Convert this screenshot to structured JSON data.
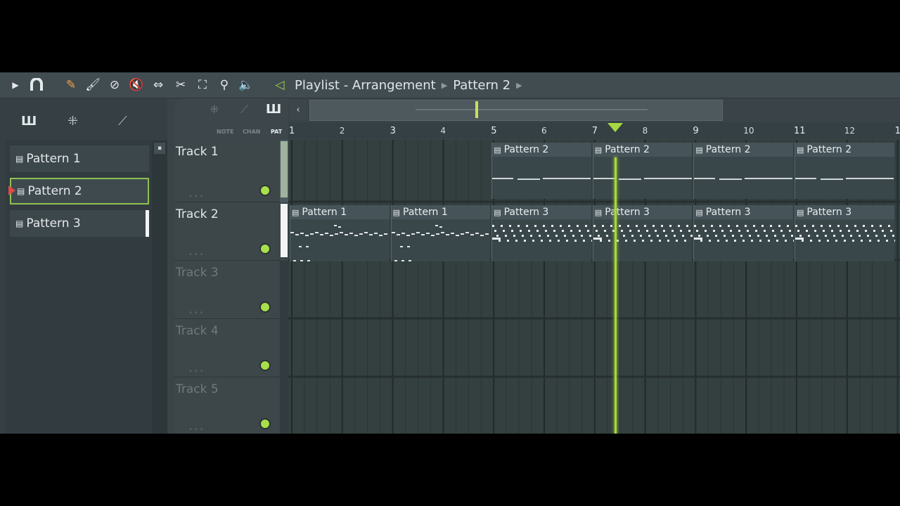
{
  "toolbar": {
    "icons": [
      "play-arrow-icon",
      "magnet-icon",
      "pencil-icon",
      "paint-brush-icon",
      "delete-icon",
      "mute-icon",
      "slip-icon",
      "slice-icon",
      "select-icon",
      "zoom-icon",
      "playback-icon"
    ],
    "title_icon": "speaker-icon",
    "breadcrumb": [
      "Playlist - Arrangement",
      "Pattern 2"
    ]
  },
  "browser": {
    "tabs": [
      "piano-roll-icon",
      "audio-icon",
      "automation-icon"
    ],
    "patterns": [
      {
        "label": "Pattern 1",
        "selected": false
      },
      {
        "label": "Pattern 2",
        "selected": true
      },
      {
        "label": "Pattern 3",
        "selected": false
      }
    ]
  },
  "view_modes": {
    "note": "NOTE",
    "chan": "CHAN",
    "pat": "PAT"
  },
  "ruler": {
    "bars": [
      "1",
      "2",
      "3",
      "4",
      "5",
      "6",
      "7",
      "8",
      "9",
      "10",
      "11",
      "12",
      "1"
    ]
  },
  "playhead_bar": 7.4,
  "tracks": [
    {
      "name": "Track 1",
      "active": true
    },
    {
      "name": "Track 2",
      "active": true
    },
    {
      "name": "Track 3",
      "active": false
    },
    {
      "name": "Track 4",
      "active": false
    },
    {
      "name": "Track 5",
      "active": false
    }
  ],
  "clips": {
    "track1": [
      {
        "label": "Pattern 2",
        "bar": 5
      },
      {
        "label": "Pattern 2",
        "bar": 7
      },
      {
        "label": "Pattern 2",
        "bar": 9
      },
      {
        "label": "Pattern 2",
        "bar": 11
      }
    ],
    "track2": [
      {
        "label": "Pattern 1",
        "bar": 1
      },
      {
        "label": "Pattern 1",
        "bar": 3
      },
      {
        "label": "Pattern 3",
        "bar": 5
      },
      {
        "label": "Pattern 3",
        "bar": 7
      },
      {
        "label": "Pattern 3",
        "bar": 9
      },
      {
        "label": "Pattern 3",
        "bar": 11
      }
    ]
  },
  "colors": {
    "accent": "#a8d83b",
    "background": "#3a4448"
  }
}
